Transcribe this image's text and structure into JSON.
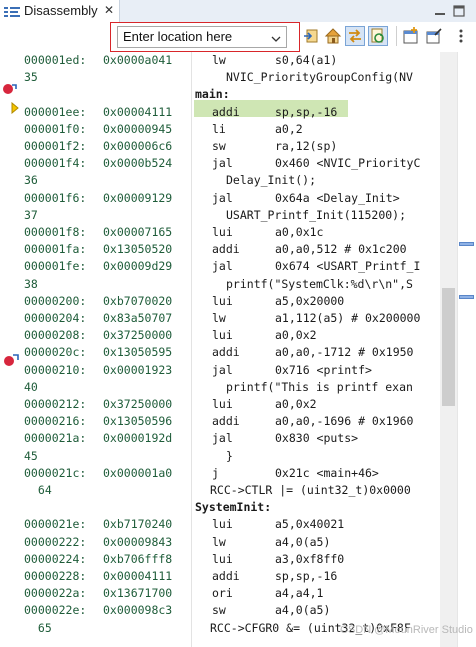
{
  "tab": {
    "title": "Disassembly",
    "close_glyph": "✕"
  },
  "toolbar": {
    "location_value": "Enter location here",
    "buttons": [
      "go-icon",
      "home-icon",
      "link-with-editor-icon",
      "refresh-icon",
      "new-view-icon",
      "pin-icon"
    ]
  },
  "colors": {
    "address": "#1e5c39",
    "current_line": "#cfe6b4",
    "highlight_box": "#d8262a"
  },
  "lines": [
    {
      "kind": "asm",
      "addr": "000001ed:",
      "opcode": "0x0000a041",
      "mn": "lw",
      "ops": "s0,64(a1)"
    },
    {
      "kind": "src",
      "num": "35",
      "text": "NVIC_PriorityGroupConfig(NV"
    },
    {
      "kind": "label",
      "text": "main:"
    },
    {
      "kind": "asm",
      "addr": "000001ee:",
      "opcode": "0x00004111",
      "mn": "addi",
      "ops": "sp,sp,-16"
    },
    {
      "kind": "asm",
      "addr": "000001f0:",
      "opcode": "0x00000945",
      "mn": "li",
      "ops": "a0,2"
    },
    {
      "kind": "asm",
      "addr": "000001f2:",
      "opcode": "0x000006c6",
      "mn": "sw",
      "ops": "ra,12(sp)"
    },
    {
      "kind": "asm",
      "addr": "000001f4:",
      "opcode": "0x0000b524",
      "mn": "jal",
      "ops": "0x460 <NVIC_PriorityC"
    },
    {
      "kind": "src",
      "num": "36",
      "text": "Delay_Init();"
    },
    {
      "kind": "asm",
      "addr": "000001f6:",
      "opcode": "0x00009129",
      "mn": "jal",
      "ops": "0x64a <Delay_Init>"
    },
    {
      "kind": "src",
      "num": "37",
      "text": "USART_Printf_Init(115200);"
    },
    {
      "kind": "asm",
      "addr": "000001f8:",
      "opcode": "0x00007165",
      "mn": "lui",
      "ops": "a0,0x1c"
    },
    {
      "kind": "asm",
      "addr": "000001fa:",
      "opcode": "0x13050520",
      "mn": "addi",
      "ops": "a0,a0,512 # 0x1c200"
    },
    {
      "kind": "asm",
      "addr": "000001fe:",
      "opcode": "0x00009d29",
      "mn": "jal",
      "ops": "0x674 <USART_Printf_I"
    },
    {
      "kind": "src",
      "num": "38",
      "text": "printf(\"SystemClk:%d\\r\\n\",S"
    },
    {
      "kind": "asm",
      "addr": "00000200:",
      "opcode": "0xb7070020",
      "mn": "lui",
      "ops": "a5,0x20000"
    },
    {
      "kind": "asm",
      "addr": "00000204:",
      "opcode": "0x83a50707",
      "mn": "lw",
      "ops": "a1,112(a5) # 0x200000"
    },
    {
      "kind": "asm",
      "addr": "00000208:",
      "opcode": "0x37250000",
      "mn": "lui",
      "ops": "a0,0x2"
    },
    {
      "kind": "asm",
      "addr": "0000020c:",
      "opcode": "0x13050595",
      "mn": "addi",
      "ops": "a0,a0,-1712 # 0x1950"
    },
    {
      "kind": "asm",
      "addr": "00000210:",
      "opcode": "0x00001923",
      "mn": "jal",
      "ops": "0x716 <printf>"
    },
    {
      "kind": "src",
      "num": "40",
      "text": "printf(\"This is printf exan"
    },
    {
      "kind": "asm",
      "addr": "00000212:",
      "opcode": "0x37250000",
      "mn": "lui",
      "ops": "a0,0x2"
    },
    {
      "kind": "asm",
      "addr": "00000216:",
      "opcode": "0x13050596",
      "mn": "addi",
      "ops": "a0,a0,-1696 # 0x1960"
    },
    {
      "kind": "asm",
      "addr": "0000021a:",
      "opcode": "0x0000192d",
      "mn": "jal",
      "ops": "0x830 <puts>"
    },
    {
      "kind": "src",
      "num": "45",
      "text": "}"
    },
    {
      "kind": "asm",
      "addr": "0000021c:",
      "opcode": "0x000001a0",
      "mn": "j",
      "ops": "0x21c <main+46>"
    },
    {
      "kind": "src",
      "num": " 64",
      "text": "RCC->CTLR |= (uint32_t)0x0000"
    },
    {
      "kind": "label",
      "text": "SystemInit:"
    },
    {
      "kind": "asm",
      "addr": "0000021e:",
      "opcode": "0xb7170240",
      "mn": "lui",
      "ops": "a5,0x40021"
    },
    {
      "kind": "asm",
      "addr": "00000222:",
      "opcode": "0x00009843",
      "mn": "lw",
      "ops": "a4,0(a5)"
    },
    {
      "kind": "asm",
      "addr": "00000224:",
      "opcode": "0xb706fff8",
      "mn": "lui",
      "ops": "a3,0xf8ff0"
    },
    {
      "kind": "asm",
      "addr": "00000228:",
      "opcode": "0x00004111",
      "mn": "addi",
      "ops": "sp,sp,-16"
    },
    {
      "kind": "asm",
      "addr": "0000022a:",
      "opcode": "0x13671700",
      "mn": "ori",
      "ops": "a4,a4,1"
    },
    {
      "kind": "asm",
      "addr": "0000022e:",
      "opcode": "0x000098c3",
      "mn": "sw",
      "ops": "a4,0(a5)"
    },
    {
      "kind": "src",
      "num": " 65",
      "text": "RCC->CFGR0 &= (uint32_t)0xF8F"
    }
  ],
  "watermark": "CSDN @MounRiver Studio"
}
